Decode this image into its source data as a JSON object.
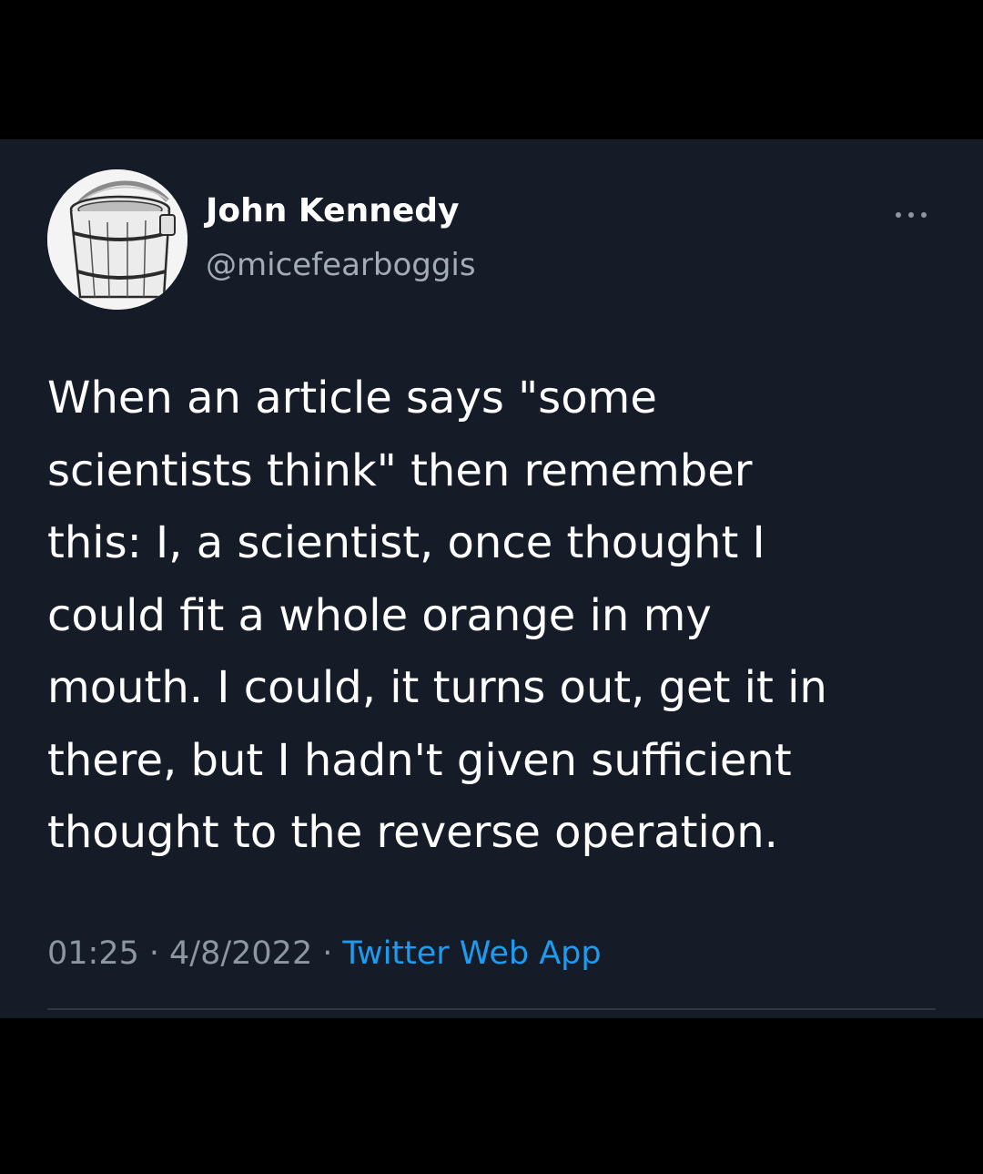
{
  "tweet": {
    "author": {
      "display_name": "John Kennedy",
      "handle": "@micefearboggis",
      "avatar_icon": "wooden-bucket-avatar"
    },
    "more_icon": "more-horizontal-icon",
    "text_lines": [
      "When an article says \"some",
      "scientists think\" then remember",
      "this: I, a scientist, once thought I",
      "could fit a whole orange in my",
      "mouth. I could, it turns out, get it in",
      "there, but I hadn't given sufficient",
      "thought to the reverse operation."
    ],
    "time": "01:25",
    "date": "4/8/2022",
    "separator": "·",
    "source": "Twitter Web App"
  },
  "colors": {
    "outer_background": "#000000",
    "card_background": "#151c28",
    "primary_text": "#ffffff",
    "secondary_text": "#8d97a1",
    "link": "#1d9bf0"
  }
}
